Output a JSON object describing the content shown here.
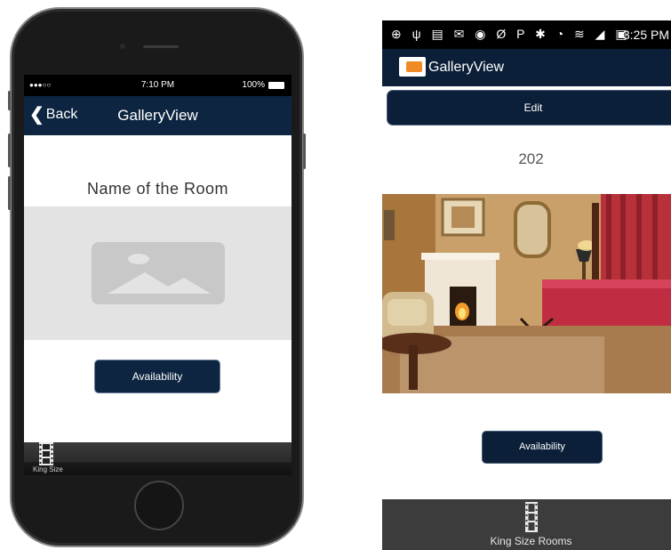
{
  "iphone": {
    "status_bar": {
      "signal": "●●●○○",
      "time": "7:10 PM",
      "battery": "100%"
    },
    "nav": {
      "back_label": "Back",
      "title": "GalleryView"
    },
    "room_name": "Name of the Room",
    "image_placeholder_icon": "image-placeholder-icon",
    "availability_label": "Availability",
    "tab": {
      "label": "King Size",
      "icon": "film-strip-icon"
    }
  },
  "android": {
    "status_bar": {
      "icons": "⊕ ψ ▤ ✉ ◉ Ø P ✱ ◔ ≋ ◢ ▣",
      "time": "3:25 PM"
    },
    "action_bar": {
      "title": "GalleryView",
      "logo_icon": "app-logo-icon"
    },
    "edit_label": "Edit",
    "room_number": "202",
    "photo_subject": "hotel-room-photo",
    "availability_label": "Availability",
    "tab": {
      "label": "King Size Rooms",
      "icon": "film-strip-icon"
    }
  },
  "colors": {
    "navy": "#0d2540",
    "tab_bar_dark": "#3c3c3c",
    "placeholder_gray": "#e3e3e3"
  }
}
